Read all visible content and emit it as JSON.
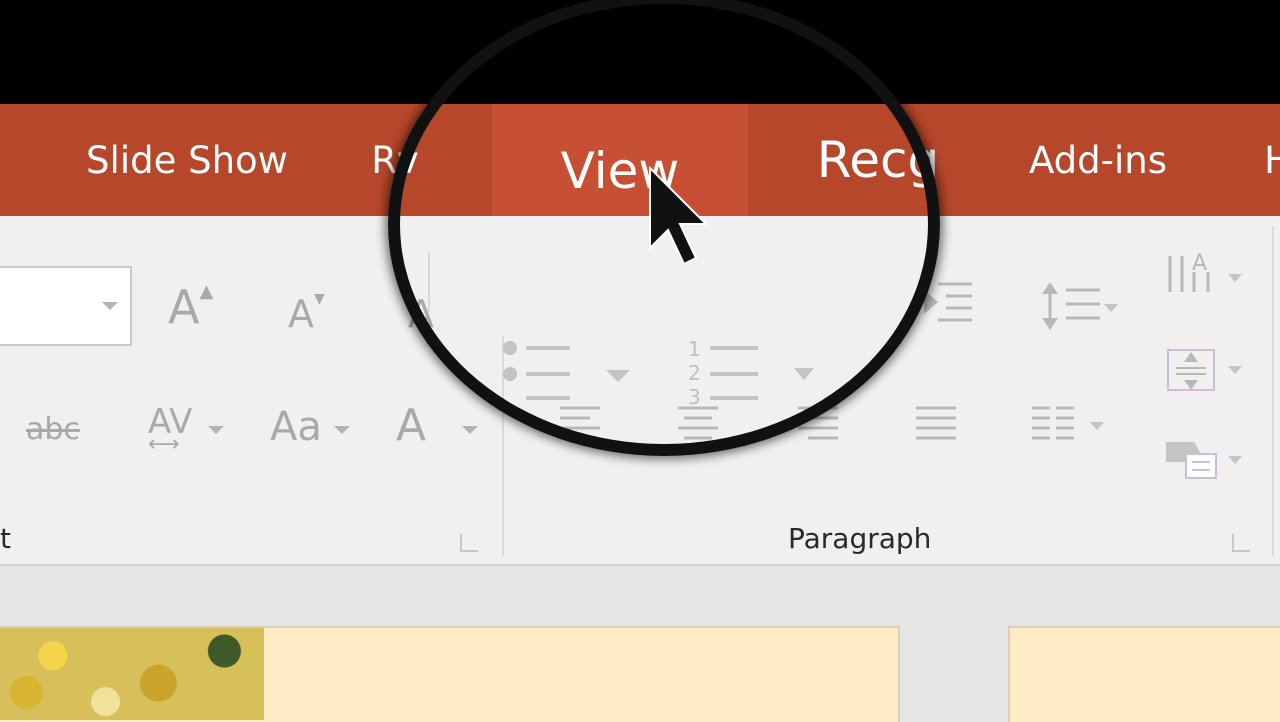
{
  "tabs": [
    {
      "label": "Slide Show",
      "active": false
    },
    {
      "label": "Rv",
      "active": false
    },
    {
      "label": "View",
      "active": true
    },
    {
      "label": "Recg",
      "active": false
    },
    {
      "label": "Add-ins",
      "active": false
    },
    {
      "label": "H",
      "active": false
    }
  ],
  "ribbon": {
    "font_group_label": "t",
    "paragraph_group_label": "Paragraph",
    "strikethrough_text": "abc",
    "char_spacing_text": "AV",
    "change_case_text": "Aa",
    "font_color_text": "A",
    "grow_font_text": "A",
    "shrink_font_text": "A",
    "text_direction_text": "A"
  },
  "colors": {
    "tab_bar": "#b7472a",
    "tab_active": "#c64f34",
    "ribbon_bg": "#f0f0f0",
    "slide_bg": "#fcebc4"
  },
  "icons": [
    "cursor-icon",
    "magnifier-lens"
  ]
}
